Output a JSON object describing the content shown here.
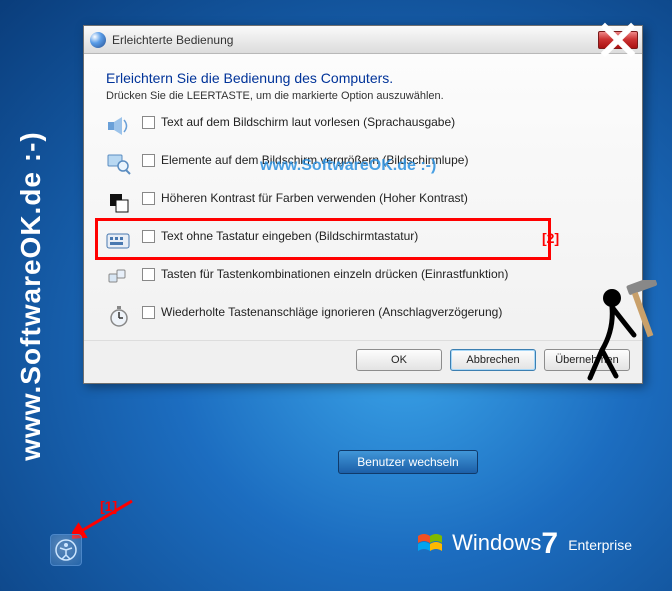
{
  "sidebar_watermark": "www.SoftwareOK.de :-)",
  "dialog": {
    "title": "Erleichterte Bedienung",
    "heading": "Erleichtern Sie die Bedienung des Computers.",
    "subheading": "Drücken Sie die LEERTASTE, um die markierte Option auszuwählen.",
    "options": [
      {
        "label": "Text auf dem Bildschirm laut vorlesen (Sprachausgabe)"
      },
      {
        "label": "Elemente auf dem Bildschirm vergrößern (Bildschirmlupe)"
      },
      {
        "label": "Höheren Kontrast für Farben verwenden (Hoher Kontrast)"
      },
      {
        "label": "Text ohne Tastatur eingeben (Bildschirmtastatur)"
      },
      {
        "label": "Tasten für Tastenkombinationen einzeln drücken (Einrastfunktion)"
      },
      {
        "label": "Wiederholte Tastenanschläge ignorieren (Anschlagverzögerung)"
      }
    ],
    "buttons": {
      "ok": "OK",
      "cancel": "Abbrechen",
      "apply": "Übernehmen"
    }
  },
  "watermark_inline": "www.SoftwareOK.de :-)",
  "markers": {
    "m1": "[1]",
    "m2": "[2]"
  },
  "switch_user": "Benutzer wechseln",
  "brand": {
    "name": "Windows",
    "version": "7",
    "edition": "Enterprise"
  }
}
